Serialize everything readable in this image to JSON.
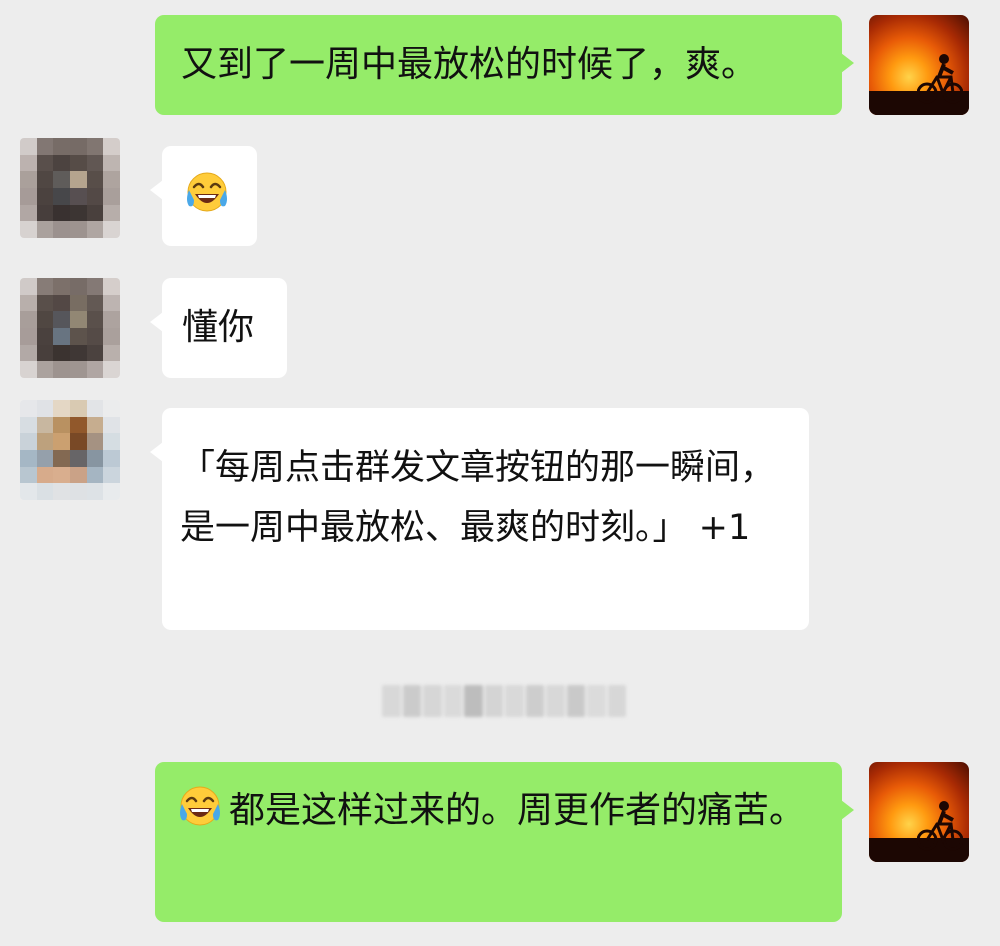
{
  "conversation": {
    "messages": [
      {
        "sender": "me",
        "text": "又到了一周中最放松的时候了，爽。",
        "emoji": ""
      },
      {
        "sender": "other",
        "text": "",
        "emoji": "tears-of-joy-emoji"
      },
      {
        "sender": "other",
        "text": "懂你",
        "emoji": ""
      },
      {
        "sender": "other",
        "text": "「每周点击群发文章按钮的那一瞬间，是一周中最放松、最爽的时刻。」 +1",
        "emoji": ""
      },
      {
        "sender": "me",
        "text": "都是这样过来的。周更作者的痛苦。",
        "emoji": "tears-of-joy-emoji"
      }
    ],
    "system_notice": "pixelated-system-notice"
  },
  "icons": {
    "my_avatar": "sunset-cyclist-avatar",
    "contact_avatars": [
      "pixelated-avatar-1",
      "pixelated-avatar-2",
      "pixelated-avatar-3"
    ]
  },
  "colors": {
    "background": "#ededed",
    "outgoing_bubble": "#95ec69",
    "incoming_bubble": "#ffffff"
  }
}
